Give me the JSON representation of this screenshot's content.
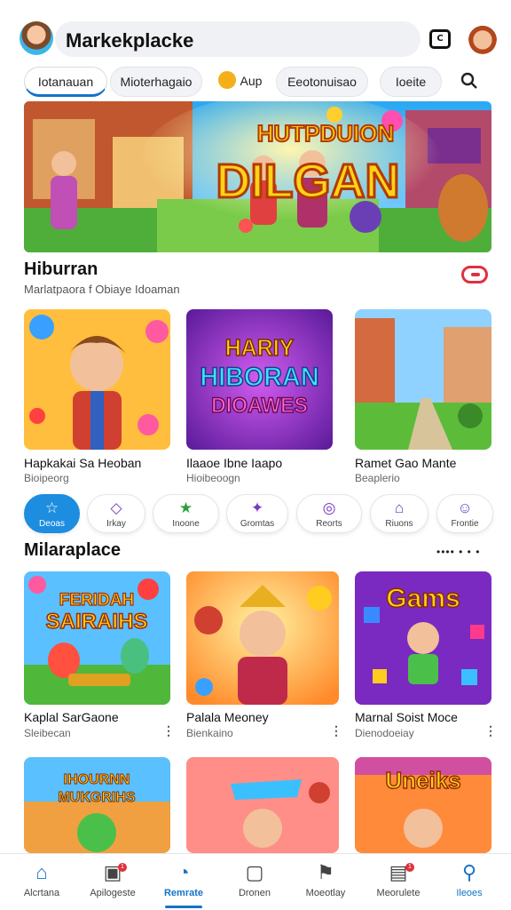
{
  "header": {
    "title": "Markekplacke",
    "action_icon": "cast-icon"
  },
  "tabs": [
    {
      "label": "Iotanauan",
      "active": true
    },
    {
      "label": "Mioterhagaio",
      "active": false
    },
    {
      "label": "Aup",
      "active": false
    },
    {
      "label": "Eeotonuisao",
      "active": false
    },
    {
      "label": "Ioeite",
      "active": false
    }
  ],
  "hero": {
    "title_top": "HUTPDUION",
    "title_main": "DILGAN"
  },
  "section1": {
    "title": "Hiburran",
    "subtitle": "Marlatpaora f Obiaye Idoaman"
  },
  "row1": [
    {
      "title": "Hapkakai Sa Heoban",
      "subtitle": "Bioipeorg"
    },
    {
      "title": "Ilaaoe Ibne Iaapo",
      "subtitle": "Hioibeoogn",
      "art_text": [
        "HARIY",
        "HIBORAN",
        "DIOAWES"
      ]
    },
    {
      "title": "Ramet Gao Mante",
      "subtitle": "Beaplerio"
    }
  ],
  "chips": [
    {
      "label": "Deoas",
      "icon": "star-icon",
      "glyph": "☆",
      "active": true
    },
    {
      "label": "Irkay",
      "icon": "diamond-icon",
      "glyph": "◇",
      "active": false
    },
    {
      "label": "Inoone",
      "icon": "star-filled-icon",
      "glyph": "★",
      "active": false
    },
    {
      "label": "Gromtas",
      "icon": "sparkle-icon",
      "glyph": "✦",
      "active": false
    },
    {
      "label": "Reorts",
      "icon": "gamepad-icon",
      "glyph": "◎",
      "active": false
    },
    {
      "label": "Riuons",
      "icon": "chart-icon",
      "glyph": "⌂",
      "active": false
    },
    {
      "label": "Frontie",
      "icon": "profile-icon",
      "glyph": "☺",
      "active": false
    }
  ],
  "section2": {
    "title": "Milaraplace",
    "more_label": "•••• • • •"
  },
  "row2": [
    {
      "title": "Kaplal SarGaone",
      "subtitle": "Sleibecan",
      "art_text": [
        "FERIDAH",
        "SAIRAIHS"
      ]
    },
    {
      "title": "Palala Meoney",
      "subtitle": "Bienkaino"
    },
    {
      "title": "Marnal Soist Moce",
      "subtitle": "Dienodoeiay",
      "art_text": [
        "Gams"
      ]
    }
  ],
  "row3": [
    {
      "art_text": [
        "IHOURNN",
        "MUKGRIHS"
      ]
    },
    {
      "art_text": []
    },
    {
      "art_text": [
        "Uneiks"
      ]
    }
  ],
  "bottom_nav": [
    {
      "label": "Alcrtana",
      "icon": "home-icon",
      "glyph": "⌂",
      "active": false,
      "badge": ""
    },
    {
      "label": "Apilogeste",
      "icon": "bag-icon",
      "glyph": "▣",
      "active": false,
      "badge": "1"
    },
    {
      "label": "Remrate",
      "icon": "search-person-icon",
      "glyph": "◔",
      "active": true,
      "badge": ""
    },
    {
      "label": "Dronen",
      "icon": "device-icon",
      "glyph": "▢",
      "active": false,
      "badge": ""
    },
    {
      "label": "Moeotlay",
      "icon": "flag-icon",
      "glyph": "⚑",
      "active": false,
      "badge": ""
    },
    {
      "label": "Meorulete",
      "icon": "chat-icon",
      "glyph": "▤",
      "active": false,
      "badge": "1"
    },
    {
      "label": "Ileoes",
      "icon": "search-icon",
      "glyph": "⚲",
      "active": false,
      "badge": ""
    }
  ],
  "colors": {
    "accent": "#1473c8",
    "chip_active": "#1c8ddf",
    "badge": "#e0303d"
  }
}
